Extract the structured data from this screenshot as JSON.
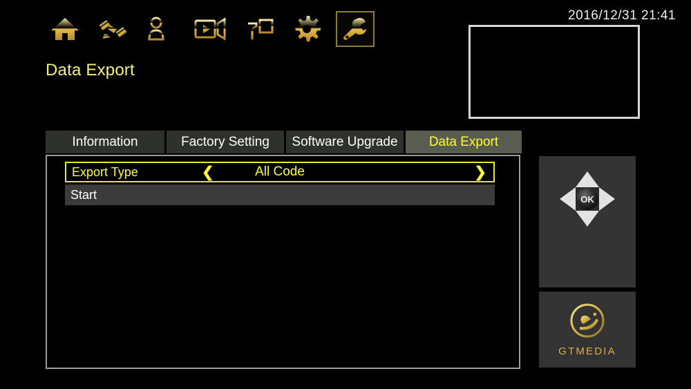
{
  "header": {
    "clock": "2016/12/31  21:41",
    "page_title": "Data Export",
    "nav_icons": [
      {
        "name": "home-icon",
        "label": "Home",
        "selected": false
      },
      {
        "name": "satellite-icon",
        "label": "Installation",
        "selected": false
      },
      {
        "name": "channel-list-icon",
        "label": "Channel",
        "selected": false
      },
      {
        "name": "video-camera-icon",
        "label": "Media",
        "selected": false
      },
      {
        "name": "media-player-icon",
        "label": "Multimedia",
        "selected": false
      },
      {
        "name": "gear-icon",
        "label": "Settings",
        "selected": false
      },
      {
        "name": "wrench-icon",
        "label": "Tools",
        "selected": true
      }
    ]
  },
  "tabs": [
    {
      "label": "Information",
      "active": false
    },
    {
      "label": "Factory Setting",
      "active": false
    },
    {
      "label": "Software Upgrade",
      "active": false
    },
    {
      "label": "Data Export",
      "active": true
    }
  ],
  "content": {
    "rows": [
      {
        "label": "Export Type",
        "value": "All Code",
        "selected": true,
        "chevron_left": "❮",
        "chevron_right": "❯"
      },
      {
        "label": "Start",
        "value": "",
        "selected": false
      }
    ]
  },
  "sidebar": {
    "dpad": {
      "ok_label": "OK",
      "up": "up-arrow",
      "down": "down-arrow",
      "left": "left-arrow",
      "right": "right-arrow"
    },
    "logo": {
      "text": "GTMEDIA",
      "mark": "satellite-dish-logo-icon"
    }
  },
  "colors": {
    "background": "#000000",
    "accent_yellow": "#ffff33",
    "title_yellow": "#f2f27a",
    "gold": "#d4b24a",
    "tab_inactive_bg": "#2e312c",
    "tab_active_bg": "#595c50",
    "row_plain_bg": "#3b3b3b",
    "panel_border": "#9d9d9d",
    "side_panel_bg": "#333333"
  }
}
